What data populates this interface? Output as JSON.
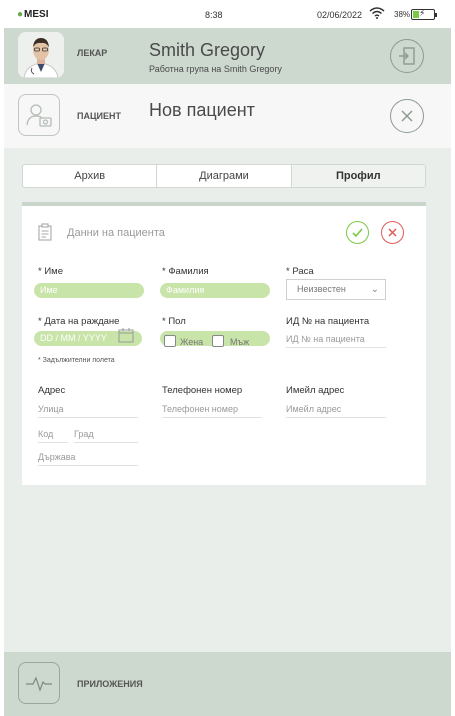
{
  "status_bar": {
    "logo": "MESI",
    "time": "8:38",
    "date": "02/06/2022",
    "battery": "38%",
    "battery_level": 0.38
  },
  "doctor": {
    "role_label": "ЛЕКАР",
    "name": "Smith Gregory",
    "group": "Работна група на Smith Gregory"
  },
  "patient_header": {
    "label": "ПАЦИЕНТ",
    "title": "Нов пациент"
  },
  "tabs": [
    {
      "label": "Архив",
      "active": false
    },
    {
      "label": "Диаграми",
      "active": false
    },
    {
      "label": "Профил",
      "active": true
    }
  ],
  "card": {
    "title": "Данни на пациента"
  },
  "form": {
    "first_name": {
      "label": "* Име",
      "placeholder": "Име"
    },
    "last_name": {
      "label": "* Фамилия",
      "placeholder": "Фамилия"
    },
    "race": {
      "label": "* Раса",
      "value": "Неизвестен"
    },
    "birth_date": {
      "label": "* Дата на раждане",
      "placeholder": "DD / MM / YYYY"
    },
    "gender": {
      "label": "* Пол",
      "options": [
        "Жена",
        "Мъж"
      ]
    },
    "patient_id": {
      "label": "ИД № на пациента",
      "placeholder": "ИД № на пациента"
    },
    "required_note": "* Задължителни полета",
    "address": {
      "label": "Адрес",
      "street": "Улица",
      "code": "Код",
      "city": "Град",
      "country": "Държава"
    },
    "phone": {
      "label": "Телефонен номер",
      "placeholder": "Телефонен номер"
    },
    "email": {
      "label": "Имейл адрес",
      "placeholder": "Имейл адрес"
    }
  },
  "footer": {
    "label": "ПРИЛОЖЕНИЯ"
  },
  "colors": {
    "accent_green": "#c8e4a8",
    "header_bg": "#cdd8cf",
    "ok": "#7ac943",
    "cancel": "#e05a5a"
  }
}
